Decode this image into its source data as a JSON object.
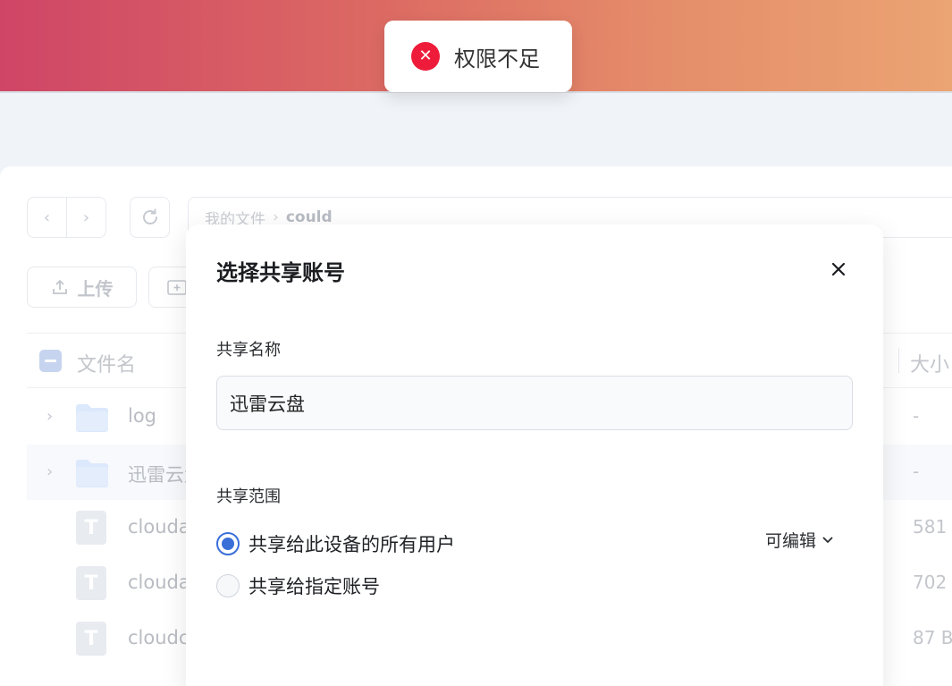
{
  "toast": {
    "message": "权限不足",
    "icon": "error-circle-icon",
    "color": "#ee1c3a"
  },
  "breadcrumb": {
    "root": "我的文件",
    "current": "could"
  },
  "toolbar": {
    "upload_label": "上传"
  },
  "file_list": {
    "header_name": "文件名",
    "header_size": "大小",
    "rows": [
      {
        "name": "log",
        "size": "-",
        "type": "folder"
      },
      {
        "name": "迅雷云盘",
        "size": "-",
        "type": "folder"
      },
      {
        "name": "clouda",
        "size": "581",
        "type": "text"
      },
      {
        "name": "clouda",
        "size": "702",
        "type": "text"
      },
      {
        "name": "cloudc",
        "size": "87 B",
        "type": "text"
      }
    ]
  },
  "modal": {
    "title": "选择共享账号",
    "share_name_label": "共享名称",
    "share_name_value": "迅雷云盘",
    "share_scope_label": "共享范围",
    "option_all": "共享给此设备的所有用户",
    "option_specific": "共享给指定账号",
    "permission": "可编辑",
    "accent": "#3a6fd8"
  }
}
